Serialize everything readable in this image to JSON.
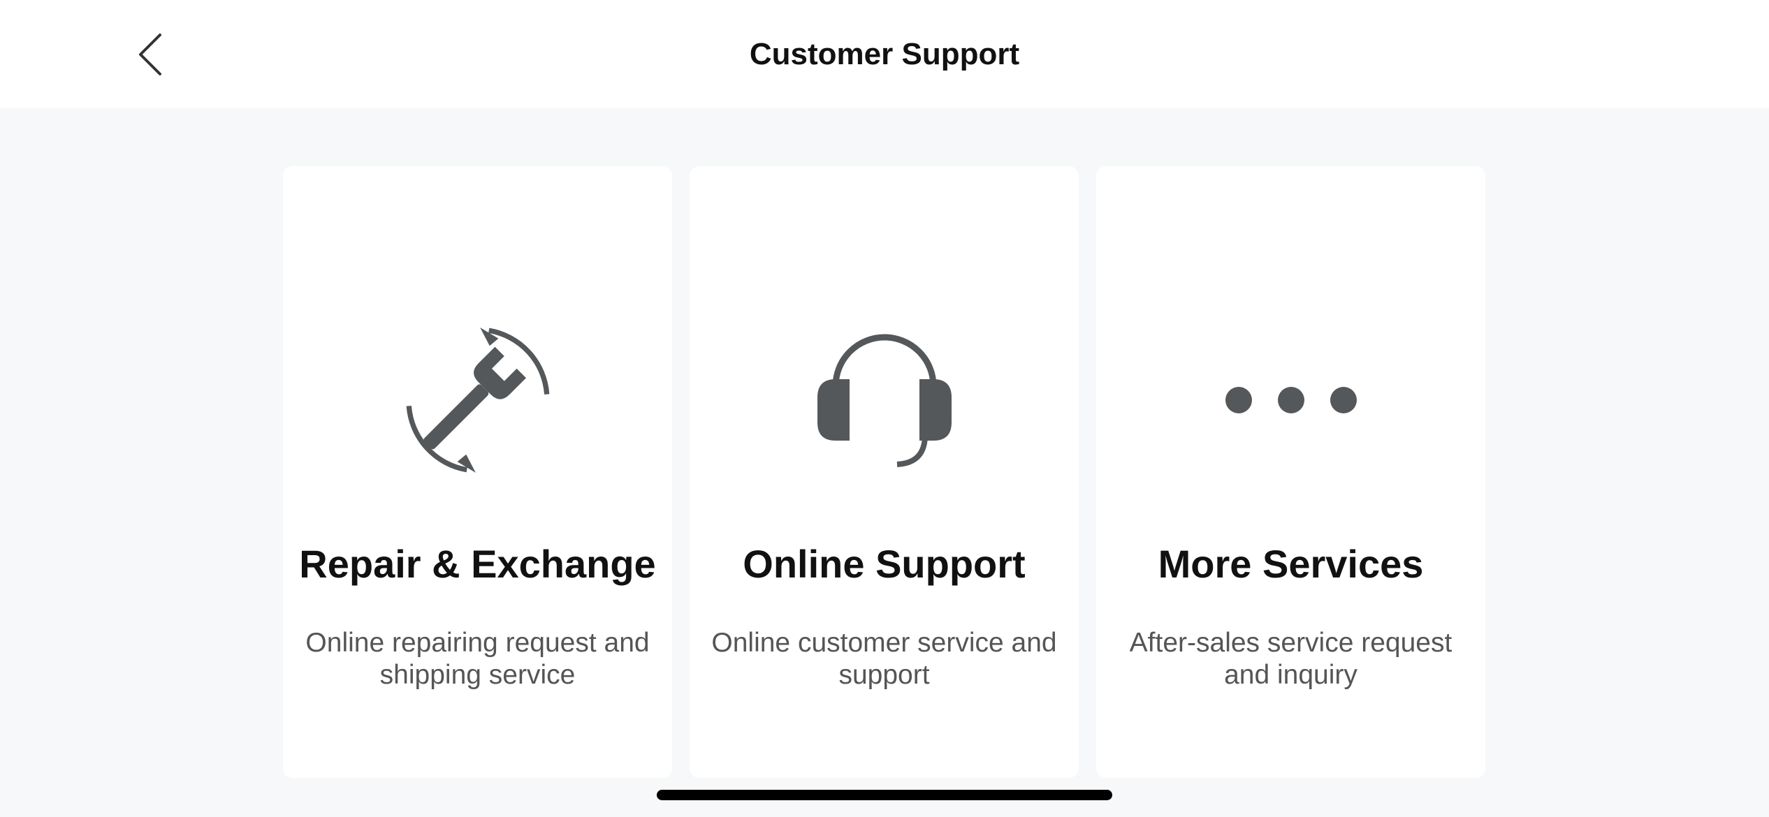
{
  "header": {
    "title": "Customer Support",
    "back_icon": "chevron-left-icon"
  },
  "cards": [
    {
      "icon": "wrench-repair-icon",
      "title": "Repair & Exchange",
      "description": "Online repairing request and shipping service"
    },
    {
      "icon": "headset-icon",
      "title": "Online Support",
      "description": "Online customer service and support"
    },
    {
      "icon": "more-dots-icon",
      "title": "More Services",
      "description": "After-sales service request and inquiry"
    }
  ],
  "colors": {
    "background": "#f7f8fa",
    "card": "#ffffff",
    "icon": "#55585a",
    "title_text": "#111111",
    "description_text": "#555555"
  }
}
